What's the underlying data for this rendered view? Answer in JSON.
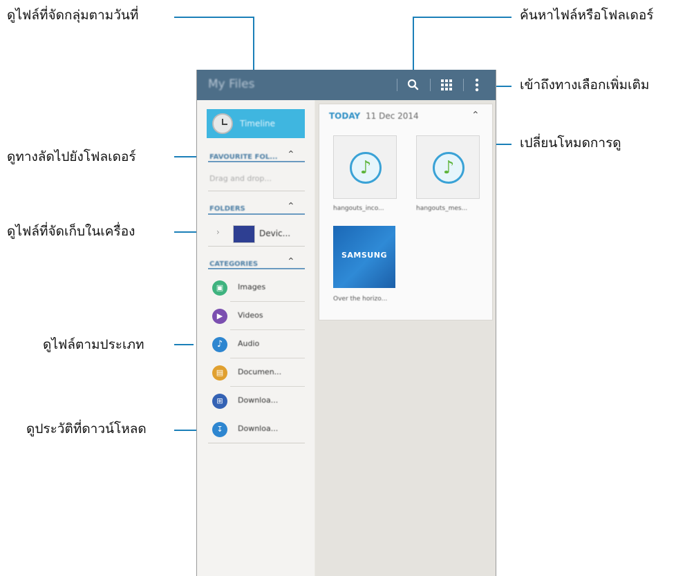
{
  "annotations": {
    "timeline": "ดูไฟล์ที่จัดกลุ่มตามวันที่",
    "search": "ค้นหาไฟล์หรือโฟลเดอร์",
    "more": "เข้าถึงทางเลือกเพิ่มเติม",
    "view_mode": "เปลี่ยนโหมดการดู",
    "favourites": "ดูทางลัดไปยังโฟลเดอร์",
    "device": "ดูไฟล์ที่จัดเก็บในเครื่อง",
    "categories": "ดูไฟล์ตามประเภท",
    "download_history": "ดูประวัติที่ดาวน์โหลด"
  },
  "appbar": {
    "title": "My Files"
  },
  "sidebar": {
    "timeline_label": "Timeline",
    "favourites_header": "FAVOURITE FOL...",
    "favourites_placeholder": "Drag and drop...",
    "folders_header": "FOLDERS",
    "device_label": "Devic...",
    "categories_header": "CATEGORIES",
    "categories": [
      {
        "label": "Images",
        "color": "#3fb37f",
        "icon": "image-icon"
      },
      {
        "label": "Videos",
        "color": "#7b4fb0",
        "icon": "video-icon"
      },
      {
        "label": "Audio",
        "color": "#2e86d0",
        "icon": "music-note-icon"
      },
      {
        "label": "Documen...",
        "color": "#e0a030",
        "icon": "document-icon"
      },
      {
        "label": "Downloa...",
        "color": "#3462b4",
        "icon": "download-apps-icon"
      }
    ],
    "download_history_label": "Downloa..."
  },
  "content": {
    "group_label": "TODAY",
    "group_date": "11 Dec 2014",
    "files": [
      {
        "name": "hangouts_inco..."
      },
      {
        "name": "hangouts_mes..."
      },
      {
        "name": "Over the horizo...",
        "thumb_text": "SAMSUNG"
      }
    ]
  }
}
